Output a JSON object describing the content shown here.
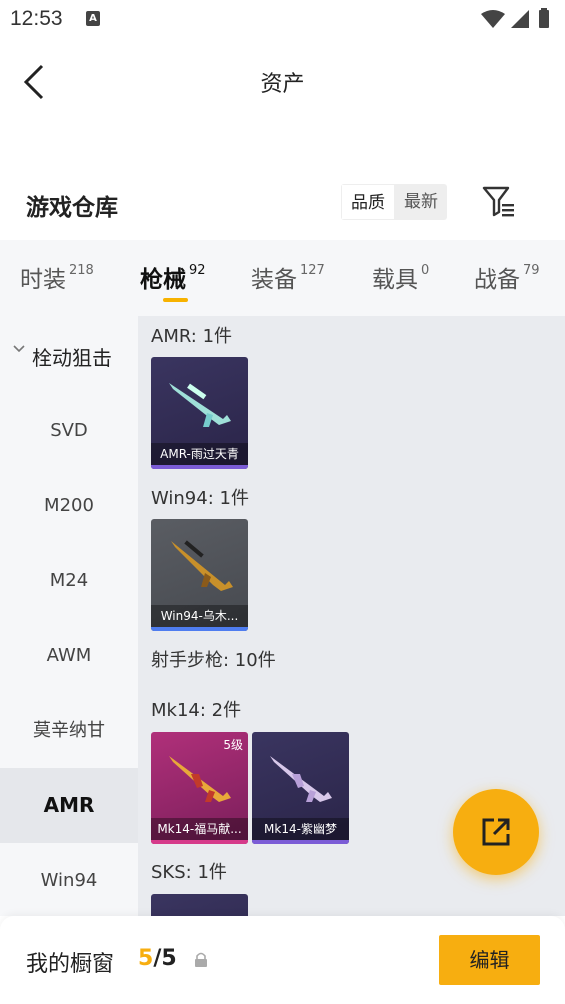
{
  "status_bar": {
    "time": "12:53",
    "notif_letter": "A"
  },
  "nav": {
    "title": "资产"
  },
  "section": {
    "title": "游戏仓库",
    "sort_options": [
      "品质",
      "最新"
    ],
    "sort_selected": "品质"
  },
  "tabs": [
    {
      "label": "时装",
      "count": "218"
    },
    {
      "label": "枪械",
      "count": "92"
    },
    {
      "label": "装备",
      "count": "127"
    },
    {
      "label": "载具",
      "count": "0"
    },
    {
      "label": "战备",
      "count": "79"
    }
  ],
  "active_tab": "枪械",
  "sidebar": {
    "group": "栓动狙击",
    "items": [
      "SVD",
      "M200",
      "M24",
      "AWM",
      "莫辛纳甘",
      "AMR",
      "Win94"
    ],
    "active": "AMR"
  },
  "content": {
    "groups": [
      {
        "title": "AMR: 1件",
        "cards": [
          {
            "label": "AMR-雨过天青",
            "badge": ""
          }
        ]
      },
      {
        "title": "Win94: 1件",
        "cards": [
          {
            "label": "Win94-乌木...",
            "badge": ""
          }
        ]
      },
      {
        "title": "射手步枪: 10件",
        "cards": []
      },
      {
        "title": "Mk14: 2件",
        "cards": [
          {
            "label": "Mk14-福马献...",
            "badge": "5级"
          },
          {
            "label": "Mk14-紫幽梦",
            "badge": ""
          }
        ]
      },
      {
        "title": "SKS: 1件",
        "cards": []
      }
    ]
  },
  "bottom_bar": {
    "label": "我的橱窗",
    "current": "5",
    "separator": "/",
    "total": "5",
    "edit_label": "编辑"
  },
  "colors": {
    "accent": "#f7ae10",
    "sidebar_bg": "#f6f7f9",
    "content_bg": "#e9ebef"
  }
}
